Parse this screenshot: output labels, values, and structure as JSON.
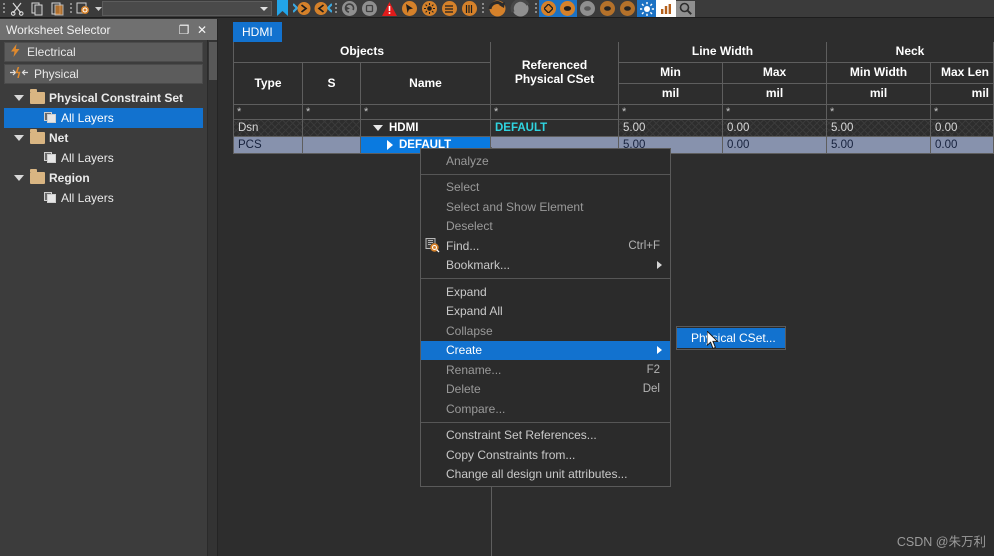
{
  "toolbar": {
    "icons": [
      {
        "name": "cut-icon",
        "glyph": "✂"
      },
      {
        "name": "copy-icon",
        "glyph": "⎘"
      },
      {
        "name": "paste-icon",
        "glyph": "⎙"
      },
      {
        "name": "zoom-find-icon",
        "glyph": "●"
      },
      {
        "name": "bookmark-icon",
        "glyph": "⚑"
      },
      {
        "name": "nav-forward-icon",
        "glyph": "❯"
      },
      {
        "name": "nav-back-icon",
        "glyph": "❮"
      },
      {
        "name": "undo-icon",
        "glyph": "↶"
      },
      {
        "name": "redo-icon",
        "glyph": "↷"
      },
      {
        "name": "warning-icon",
        "glyph": "▲"
      },
      {
        "name": "cursor-select-icon",
        "glyph": "➤"
      },
      {
        "name": "settings-gear-icon",
        "glyph": "⚙"
      },
      {
        "name": "list-icon",
        "glyph": "≡"
      },
      {
        "name": "columns-icon",
        "glyph": "⦀"
      },
      {
        "name": "refresh-icon",
        "glyph": "↺"
      },
      {
        "name": "analyze-icon",
        "glyph": "◔"
      },
      {
        "name": "electrical-mode-icon",
        "glyph": "◇"
      },
      {
        "name": "physical-mode-icon",
        "glyph": "●"
      },
      {
        "name": "spacing-mode-icon",
        "glyph": "●"
      },
      {
        "name": "same-net-icon",
        "glyph": "●"
      },
      {
        "name": "properties-icon",
        "glyph": "●"
      },
      {
        "name": "highlight-icon",
        "glyph": "☀"
      },
      {
        "name": "chart-icon",
        "glyph": "█"
      },
      {
        "name": "magnifier-icon",
        "glyph": "⚲"
      }
    ],
    "search_placeholder": ""
  },
  "panel": {
    "title": "Worksheet Selector",
    "restore_label": "❐",
    "close_label": "✕",
    "buttons": [
      {
        "label": "Electrical",
        "icon": "lightning-icon"
      },
      {
        "label": "Physical",
        "icon": "arrows-icon"
      }
    ],
    "tree": [
      {
        "label": "Physical Constraint Set",
        "type": "group"
      },
      {
        "label": "All Layers",
        "type": "child",
        "selected": true
      },
      {
        "label": "Net",
        "type": "group"
      },
      {
        "label": "All Layers",
        "type": "child",
        "selected": false
      },
      {
        "label": "Region",
        "type": "group"
      },
      {
        "label": "All Layers",
        "type": "child",
        "selected": false
      }
    ]
  },
  "worksheet": {
    "tab": "HDMI",
    "group_headers": [
      {
        "label": "Objects",
        "span": 3
      },
      {
        "label": "Referenced Physical CSet",
        "span": 1,
        "rowspan": true
      },
      {
        "label": "Line Width",
        "span": 2
      },
      {
        "label": "Neck",
        "span": 2
      }
    ],
    "column_headers": [
      "Type",
      "S",
      "Name",
      "Referenced Physical CSet",
      "Min",
      "Max",
      "Min Width",
      "Max Len"
    ],
    "unit_row": [
      "",
      "",
      "",
      "",
      "mil",
      "mil",
      "mil",
      "mil"
    ],
    "filter_row": [
      "*",
      "*",
      "*",
      "*",
      "*",
      "*",
      "*",
      "*"
    ],
    "rows": [
      {
        "type": "Dsn",
        "s": "",
        "name": "HDMI",
        "indent": 0,
        "expander": "down",
        "referenced_cset": "DEFAULT",
        "line_width_min": "5.00",
        "line_width_max": "0.00",
        "neck_min_width": "5.00",
        "neck_max_len": "0.00",
        "selected": false
      },
      {
        "type": "PCS",
        "s": "",
        "name": "DEFAULT",
        "indent": 1,
        "expander": "right",
        "referenced_cset": "",
        "line_width_min": "5.00",
        "line_width_max": "0.00",
        "neck_min_width": "5.00",
        "neck_max_len": "0.00",
        "selected": true
      }
    ]
  },
  "context_menu": {
    "items": [
      {
        "label": "Analyze",
        "accel": "",
        "state": "dim",
        "icon": "",
        "submenu": false,
        "separator_after": true
      },
      {
        "label": "Select",
        "accel": "",
        "state": "dim",
        "icon": "",
        "submenu": false
      },
      {
        "label": "Select and Show Element",
        "accel": "",
        "state": "dim",
        "icon": "",
        "submenu": false
      },
      {
        "label": "Deselect",
        "accel": "",
        "state": "dim",
        "icon": "",
        "submenu": false
      },
      {
        "label": "Find...",
        "accel": "Ctrl+F",
        "state": "normal",
        "icon": "find-icon",
        "submenu": false
      },
      {
        "label": "Bookmark...",
        "accel": "",
        "state": "normal",
        "icon": "",
        "submenu": true,
        "separator_after": true
      },
      {
        "label": "Expand",
        "accel": "",
        "state": "normal",
        "icon": "",
        "submenu": false
      },
      {
        "label": "Expand All",
        "accel": "",
        "state": "normal",
        "icon": "",
        "submenu": false
      },
      {
        "label": "Collapse",
        "accel": "",
        "state": "dim",
        "icon": "",
        "submenu": false
      },
      {
        "label": "Create",
        "accel": "",
        "state": "selected",
        "icon": "",
        "submenu": true
      },
      {
        "label": "Rename...",
        "accel": "F2",
        "state": "dim",
        "icon": "",
        "submenu": false
      },
      {
        "label": "Delete",
        "accel": "Del",
        "state": "dim",
        "icon": "",
        "submenu": false
      },
      {
        "label": "Compare...",
        "accel": "",
        "state": "dim",
        "icon": "",
        "submenu": false,
        "separator_after": true
      },
      {
        "label": "Constraint Set References...",
        "accel": "",
        "state": "normal",
        "icon": "",
        "submenu": false
      },
      {
        "label": "Copy Constraints from...",
        "accel": "",
        "state": "normal",
        "icon": "",
        "submenu": false
      },
      {
        "label": "Change all design unit attributes...",
        "accel": "",
        "state": "normal",
        "icon": "",
        "submenu": false
      }
    ],
    "submenu": {
      "items": [
        {
          "label": "Physical CSet...",
          "state": "selected"
        }
      ]
    }
  },
  "watermark": "CSDN @朱万利",
  "colors": {
    "accent_blue": "#1272cf",
    "row_select": "#8792ad",
    "cyan_value": "#2fd4e0",
    "orange_icon": "#d5812a",
    "folder": "#d9b582"
  }
}
